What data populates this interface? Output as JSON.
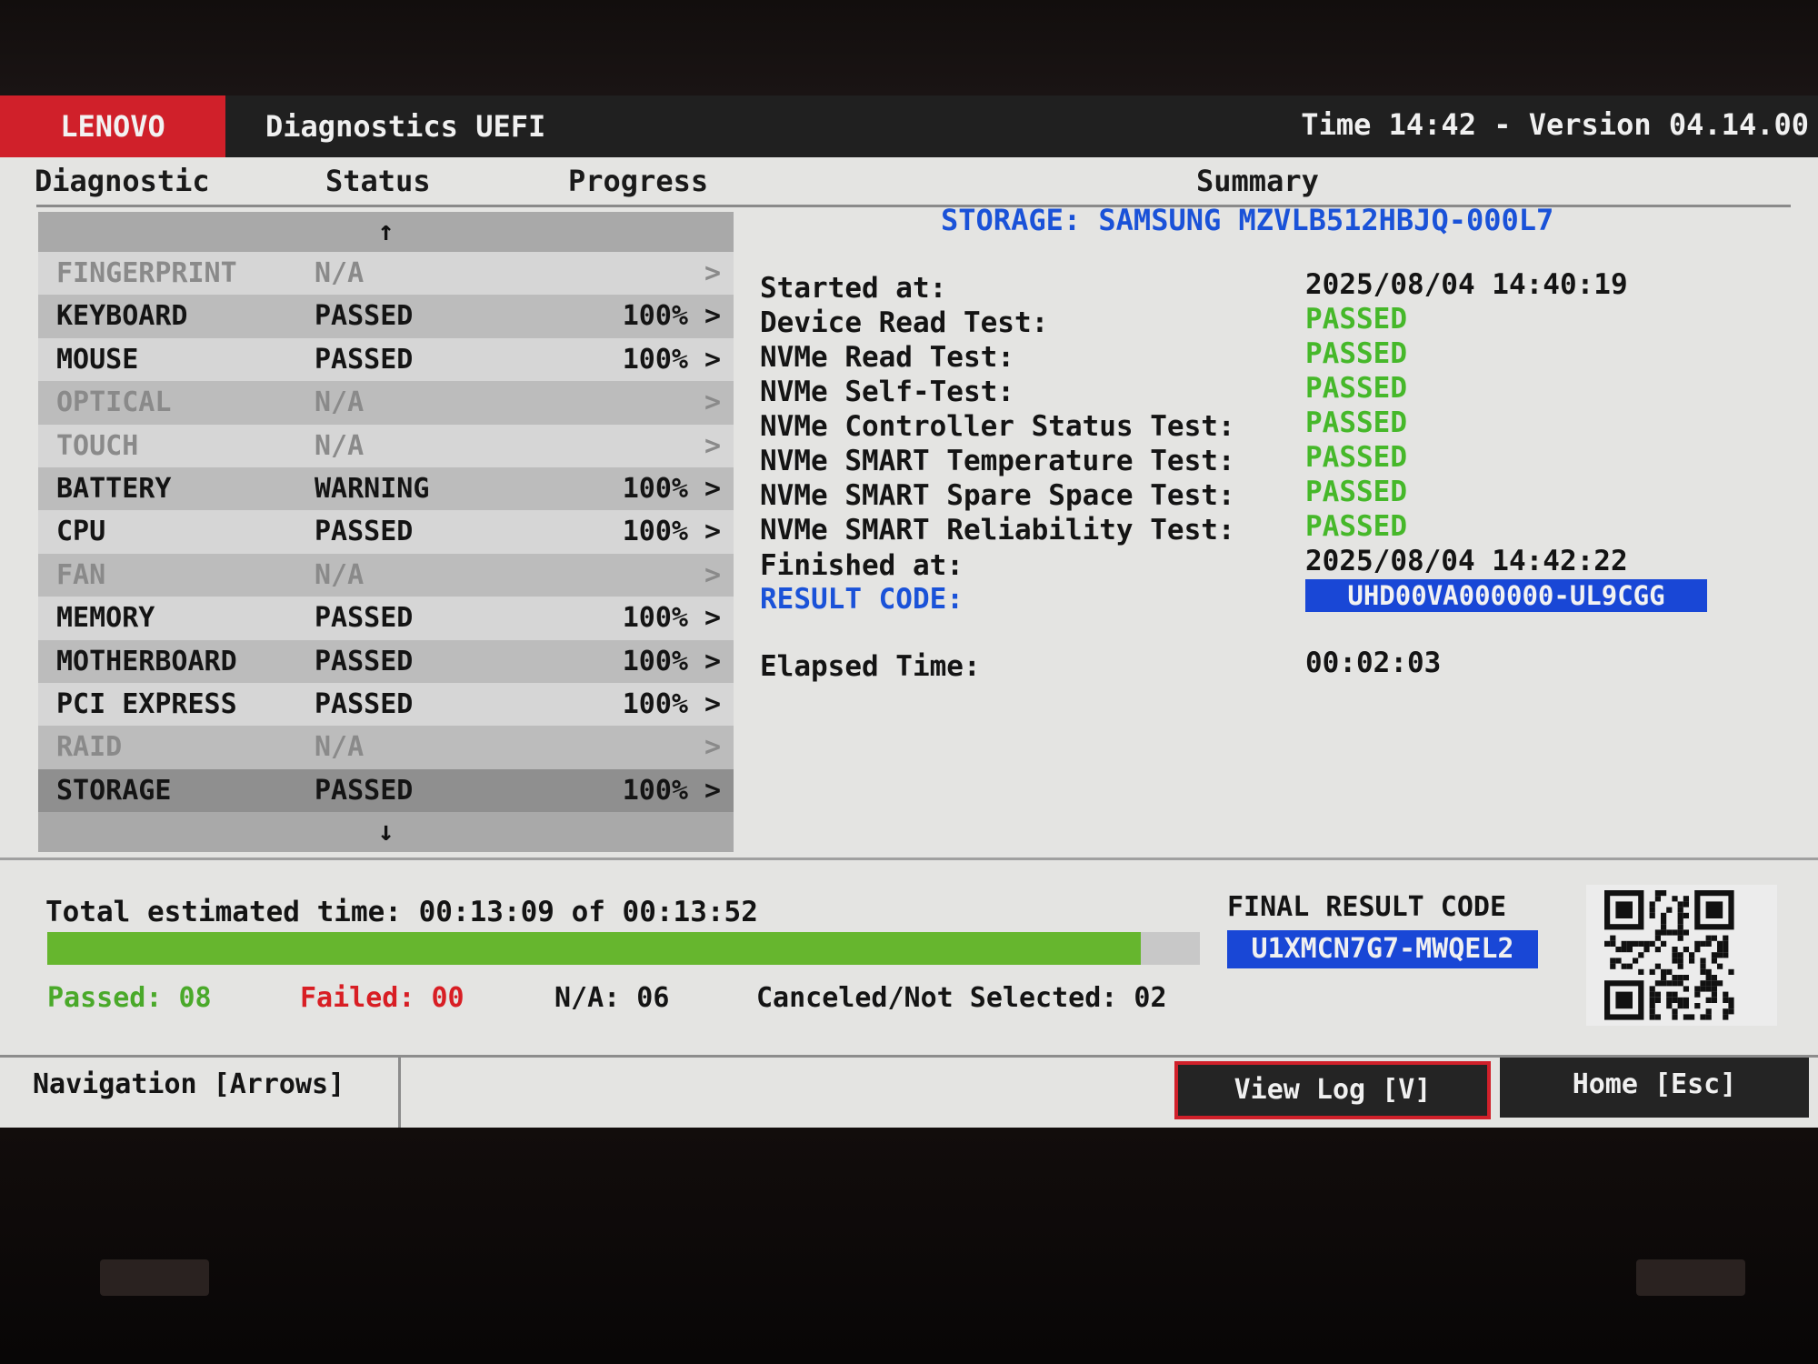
{
  "titlebar": {
    "brand": "LENOVO",
    "title": "Diagnostics UEFI",
    "time_version": "Time 14:42 - Version 04.14.00"
  },
  "columns": {
    "diagnostic": "Diagnostic",
    "status": "Status",
    "progress": "Progress",
    "summary": "Summary"
  },
  "list": {
    "scroll_up": "↑",
    "scroll_down": "↓",
    "rows": [
      {
        "name": "FINGERPRINT",
        "status": "N/A",
        "progress": "",
        "chevron": ">"
      },
      {
        "name": "KEYBOARD",
        "status": "PASSED",
        "progress": "100%",
        "chevron": ">"
      },
      {
        "name": "MOUSE",
        "status": "PASSED",
        "progress": "100%",
        "chevron": ">"
      },
      {
        "name": "OPTICAL",
        "status": "N/A",
        "progress": "",
        "chevron": ">"
      },
      {
        "name": "TOUCH",
        "status": "N/A",
        "progress": "",
        "chevron": ">"
      },
      {
        "name": "BATTERY",
        "status": "WARNING",
        "progress": "100%",
        "chevron": ">"
      },
      {
        "name": "CPU",
        "status": "PASSED",
        "progress": "100%",
        "chevron": ">"
      },
      {
        "name": "FAN",
        "status": "N/A",
        "progress": "",
        "chevron": ">"
      },
      {
        "name": "MEMORY",
        "status": "PASSED",
        "progress": "100%",
        "chevron": ">"
      },
      {
        "name": "MOTHERBOARD",
        "status": "PASSED",
        "progress": "100%",
        "chevron": ">"
      },
      {
        "name": "PCI EXPRESS",
        "status": "PASSED",
        "progress": "100%",
        "chevron": ">"
      },
      {
        "name": "RAID",
        "status": "N/A",
        "progress": "",
        "chevron": ">"
      },
      {
        "name": "STORAGE",
        "status": "PASSED",
        "progress": "100%",
        "chevron": ">"
      }
    ]
  },
  "summary": {
    "title": "STORAGE: SAMSUNG MZVLB512HBJQ-000L7",
    "started_label": "Started at:",
    "started_value": "2025/08/04 14:40:19",
    "tests": [
      {
        "label": "Device Read Test:",
        "result": "PASSED"
      },
      {
        "label": "NVMe Read Test:",
        "result": "PASSED"
      },
      {
        "label": "NVMe Self-Test:",
        "result": "PASSED"
      },
      {
        "label": "NVMe Controller Status Test:",
        "result": "PASSED"
      },
      {
        "label": "NVMe SMART Temperature Test:",
        "result": "PASSED"
      },
      {
        "label": "NVMe SMART Spare Space Test:",
        "result": "PASSED"
      },
      {
        "label": "NVMe SMART Reliability Test:",
        "result": "PASSED"
      }
    ],
    "finished_label": "Finished at:",
    "finished_value": "2025/08/04 14:42:22",
    "result_code_label": "RESULT CODE:",
    "result_code_value": "UHD00VA000000-UL9CGG",
    "elapsed_label": "Elapsed Time:",
    "elapsed_value": "00:02:03"
  },
  "totals": {
    "total_time": "Total estimated time: 00:13:09 of 00:13:52",
    "progress_fraction": 0.9484,
    "passed": "Passed: 08",
    "failed": "Failed: 00",
    "na": "N/A: 06",
    "canceled": "Canceled/Not Selected: 02"
  },
  "final_result": {
    "label": "FINAL RESULT CODE",
    "code": "U1XMCN7G7-MWQEL2",
    "qr_icon": "qr-code-icon"
  },
  "statusbar": {
    "navigation": "Navigation [Arrows]",
    "view_log": "View Log [V]",
    "home": "Home [Esc]"
  },
  "colors": {
    "brand_red": "#d0202a",
    "pass_green": "#46b82a",
    "fail_red": "#d81e24",
    "link_blue": "#1a52d8",
    "code_blue": "#1947d6",
    "progress_green": "#66b62e"
  }
}
